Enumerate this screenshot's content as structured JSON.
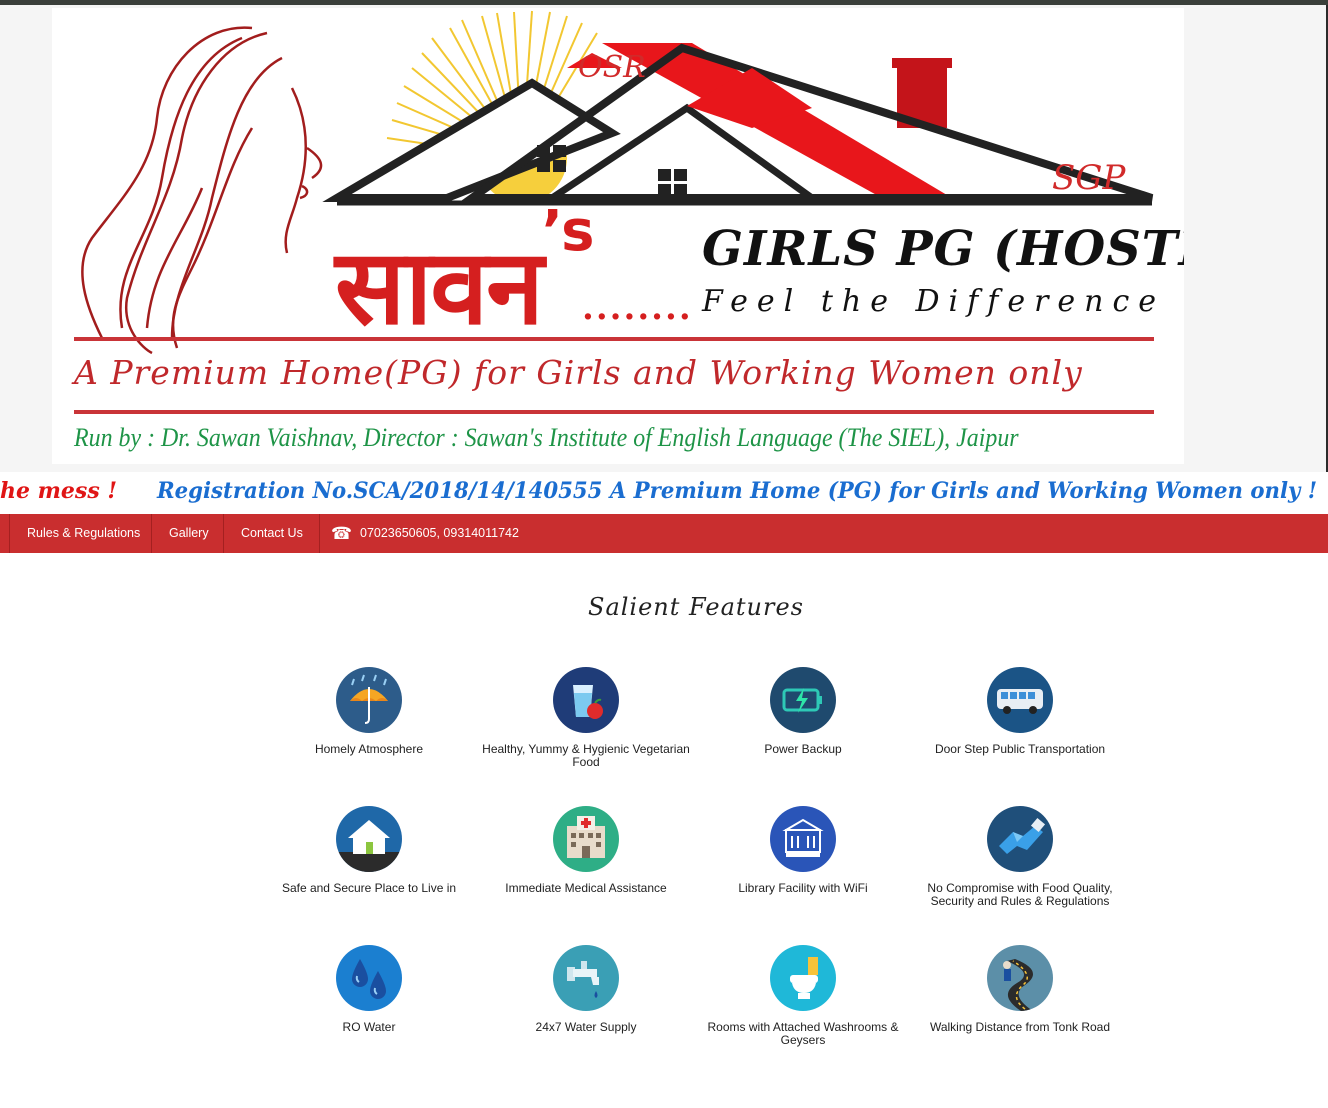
{
  "banner": {
    "osr": "OSR",
    "sgp": "SGP",
    "hindi_name": "सावन",
    "apostrophe": "’s",
    "dots": "........",
    "brand": "GIRLS PG (HOSTEL)",
    "tagline": "Feel the Difference",
    "premium": "A Premium Home(PG) for Girls and Working Women only",
    "run_by": "Run by : Dr. Sawan Vaishnav, Director : Sawan's Institute of English Language (The SIEL), Jaipur"
  },
  "marquee": {
    "part1": "he mess !",
    "part2": "Registration No.SCA/2018/14/140555 A Premium Home (PG) for Girls and Working Women only !"
  },
  "nav": {
    "items": [
      {
        "label": "Rules & Regulations"
      },
      {
        "label": "Gallery"
      },
      {
        "label": "Contact Us"
      }
    ],
    "phone": "07023650605, 09314011742"
  },
  "features": {
    "title": "Salient Features",
    "items": [
      {
        "label": "Homely Atmosphere",
        "icon": "umbrella-icon",
        "color": "#2d5c8a"
      },
      {
        "label": "Healthy, Yummy & Hygienic Vegetarian Food",
        "icon": "glass-apple-icon",
        "color": "#1f3c78"
      },
      {
        "label": "Power Backup",
        "icon": "battery-icon",
        "color": "#1f4a6e"
      },
      {
        "label": "Door Step Public Transportation",
        "icon": "bus-icon",
        "color": "#1b5486"
      },
      {
        "label": "Safe and Secure Place to Live in",
        "icon": "house-icon",
        "color": "#1f68a8"
      },
      {
        "label": "Immediate Medical Assistance",
        "icon": "hospital-icon",
        "color": "#2eae86"
      },
      {
        "label": "Library Facility with WiFi",
        "icon": "library-icon",
        "color": "#2a55b8"
      },
      {
        "label": "No Compromise with Food Quality, Security and Rules & Regulations",
        "icon": "handshake-icon",
        "color": "#1f4f7a"
      },
      {
        "label": "RO Water",
        "icon": "water-drops-icon",
        "color": "#1b7fd0"
      },
      {
        "label": "24x7 Water Supply",
        "icon": "tap-icon",
        "color": "#3a9fb5"
      },
      {
        "label": "Rooms with Attached Washrooms & Geysers",
        "icon": "toilet-icon",
        "color": "#1fb8d8"
      },
      {
        "label": "Walking Distance from Tonk Road",
        "icon": "road-walker-icon",
        "color": "#5c8fa8"
      }
    ]
  }
}
